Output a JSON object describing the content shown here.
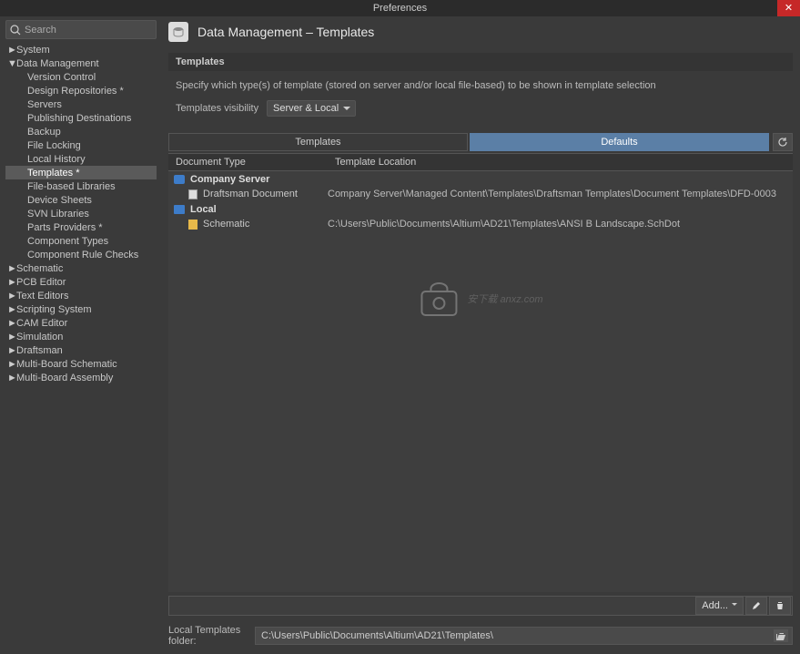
{
  "window": {
    "title": "Preferences"
  },
  "search": {
    "placeholder": "Search"
  },
  "tree": [
    {
      "label": "System",
      "level": 0,
      "caret": "►",
      "sel": false
    },
    {
      "label": "Data Management",
      "level": 0,
      "caret": "▼",
      "sel": false
    },
    {
      "label": "Version Control",
      "level": 1,
      "sel": false
    },
    {
      "label": "Design Repositories *",
      "level": 1,
      "sel": false
    },
    {
      "label": "Servers",
      "level": 1,
      "sel": false
    },
    {
      "label": "Publishing Destinations",
      "level": 1,
      "sel": false
    },
    {
      "label": "Backup",
      "level": 1,
      "sel": false
    },
    {
      "label": "File Locking",
      "level": 1,
      "sel": false
    },
    {
      "label": "Local History",
      "level": 1,
      "sel": false
    },
    {
      "label": "Templates *",
      "level": 1,
      "sel": true
    },
    {
      "label": "File-based Libraries",
      "level": 1,
      "sel": false
    },
    {
      "label": "Device Sheets",
      "level": 1,
      "sel": false
    },
    {
      "label": "SVN Libraries",
      "level": 1,
      "sel": false
    },
    {
      "label": "Parts Providers *",
      "level": 1,
      "sel": false
    },
    {
      "label": "Component Types",
      "level": 1,
      "sel": false
    },
    {
      "label": "Component Rule Checks",
      "level": 1,
      "sel": false
    },
    {
      "label": "Schematic",
      "level": 0,
      "caret": "►",
      "sel": false
    },
    {
      "label": "PCB Editor",
      "level": 0,
      "caret": "►",
      "sel": false
    },
    {
      "label": "Text Editors",
      "level": 0,
      "caret": "►",
      "sel": false
    },
    {
      "label": "Scripting System",
      "level": 0,
      "caret": "►",
      "sel": false
    },
    {
      "label": "CAM Editor",
      "level": 0,
      "caret": "►",
      "sel": false
    },
    {
      "label": "Simulation",
      "level": 0,
      "caret": "►",
      "sel": false
    },
    {
      "label": "Draftsman",
      "level": 0,
      "caret": "►",
      "sel": false
    },
    {
      "label": "Multi-Board Schematic",
      "level": 0,
      "caret": "►",
      "sel": false
    },
    {
      "label": "Multi-Board Assembly",
      "level": 0,
      "caret": "►",
      "sel": false
    }
  ],
  "page": {
    "title": "Data Management – Templates",
    "section": "Templates",
    "description": "Specify which type(s) of template (stored on server and/or local file-based) to be shown in template selection",
    "vis_label": "Templates visibility",
    "vis_value": "Server & Local"
  },
  "tabs": {
    "templates": "Templates",
    "defaults": "Defaults"
  },
  "columns": {
    "doc": "Document Type",
    "loc": "Template Location"
  },
  "groups": [
    {
      "name": "Company Server",
      "icon": "cloud",
      "items": [
        {
          "doc": "Draftsman Document",
          "icon": "gray",
          "loc": "Company Server\\Managed Content\\Templates\\Draftsman Templates\\Document Templates\\DFD-0003"
        }
      ]
    },
    {
      "name": "Local",
      "icon": "disk",
      "items": [
        {
          "doc": "Schematic",
          "icon": "yellow",
          "loc": "C:\\Users\\Public\\Documents\\Altium\\AD21\\Templates\\ANSI B Landscape.SchDot"
        }
      ]
    }
  ],
  "actions": {
    "add": "Add..."
  },
  "footer": {
    "label": "Local Templates folder:",
    "path": "C:\\Users\\Public\\Documents\\Altium\\AD21\\Templates\\"
  },
  "watermark": "安下载  anxz.com"
}
